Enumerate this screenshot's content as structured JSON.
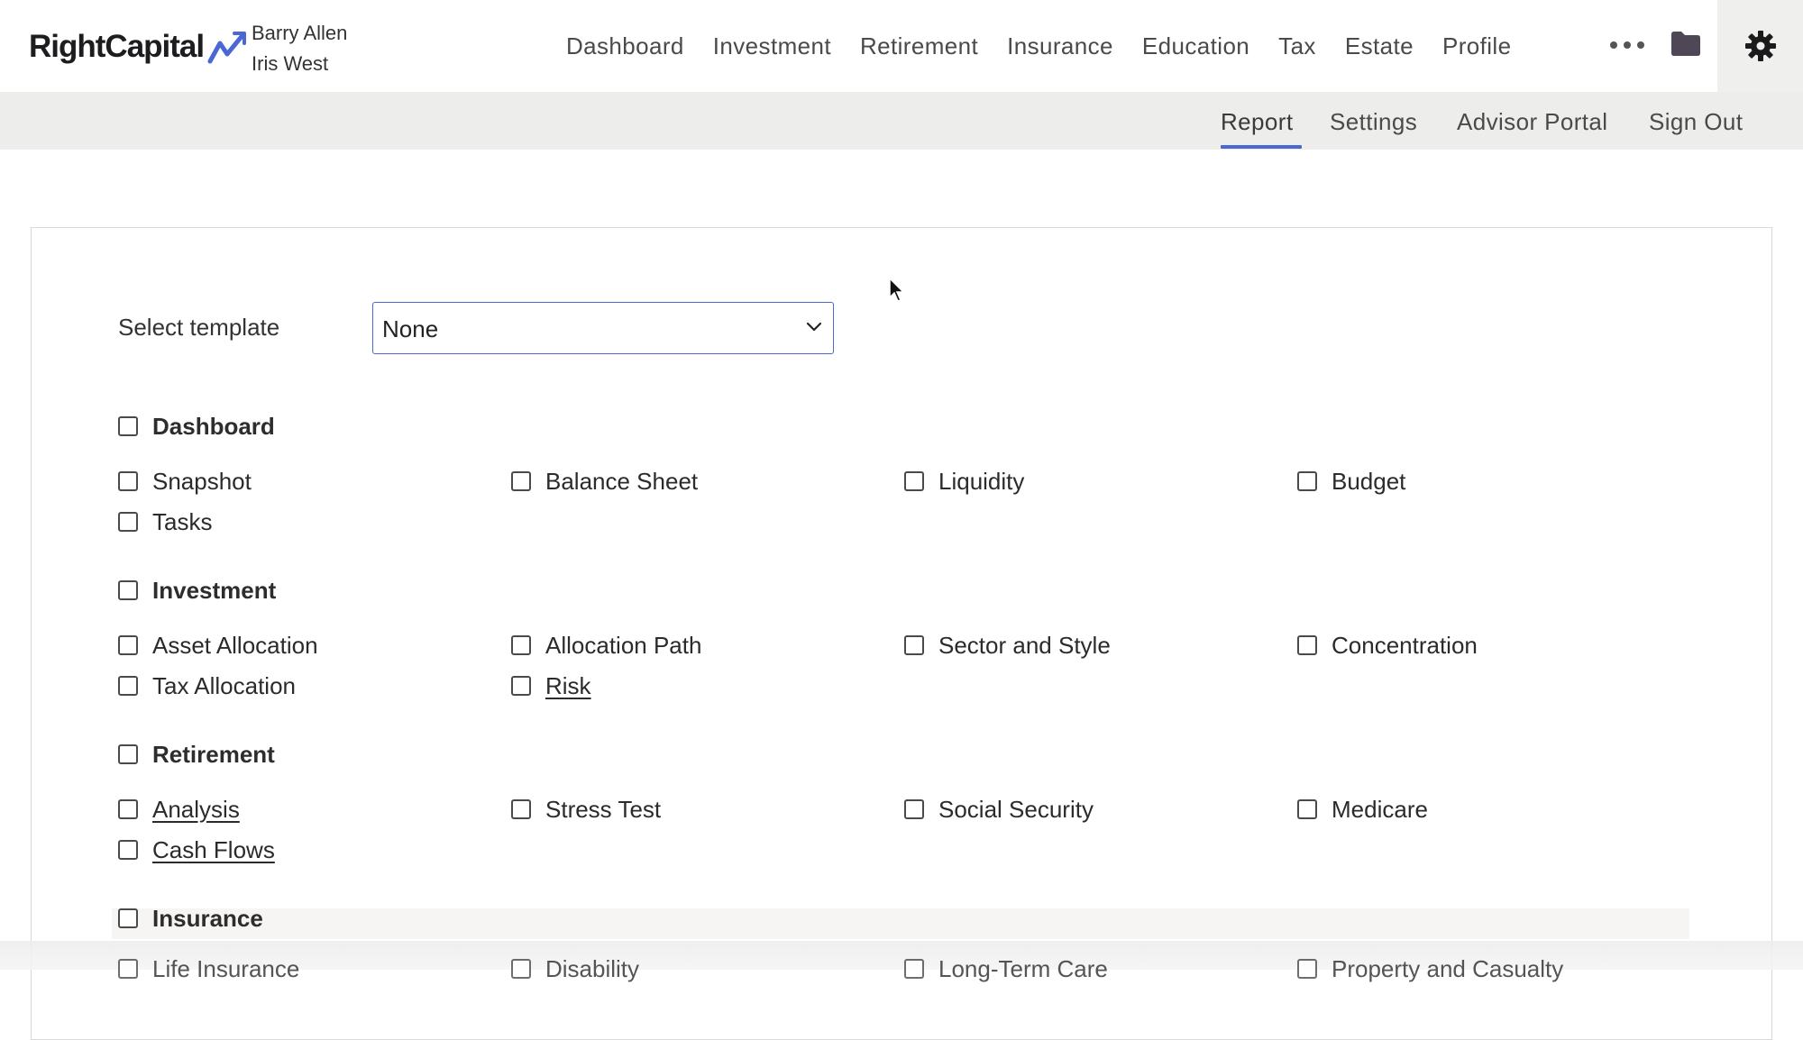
{
  "brand": {
    "name": "RightCapital"
  },
  "clients": [
    "Barry Allen",
    "Iris West"
  ],
  "nav": {
    "items": [
      "Dashboard",
      "Investment",
      "Retirement",
      "Insurance",
      "Education",
      "Tax",
      "Estate",
      "Profile"
    ],
    "icons": [
      "more-icon",
      "folder-icon",
      "gear-icon"
    ]
  },
  "subnav": {
    "items": [
      "Report",
      "Settings",
      "Advisor Portal",
      "Sign Out"
    ],
    "active": "Report",
    "accent_color": "#4b67d6"
  },
  "template": {
    "label": "Select template",
    "value": "None"
  },
  "sections": [
    {
      "title": "Dashboard",
      "items": [
        {
          "label": "Snapshot"
        },
        {
          "label": "Balance Sheet"
        },
        {
          "label": "Liquidity"
        },
        {
          "label": "Budget"
        },
        {
          "label": "Tasks"
        }
      ]
    },
    {
      "title": "Investment",
      "items": [
        {
          "label": "Asset Allocation"
        },
        {
          "label": "Allocation Path"
        },
        {
          "label": "Sector and Style"
        },
        {
          "label": "Concentration"
        },
        {
          "label": "Tax Allocation"
        },
        {
          "label": "Risk"
        }
      ]
    },
    {
      "title": "Retirement",
      "items": [
        {
          "label": "Analysis"
        },
        {
          "label": "Stress Test"
        },
        {
          "label": "Social Security"
        },
        {
          "label": "Medicare"
        },
        {
          "label": "Cash Flows"
        }
      ]
    },
    {
      "title": "Insurance",
      "items": [
        {
          "label": "Life Insurance"
        },
        {
          "label": "Disability"
        },
        {
          "label": "Long-Term Care"
        },
        {
          "label": "Property and Casualty"
        }
      ]
    }
  ]
}
